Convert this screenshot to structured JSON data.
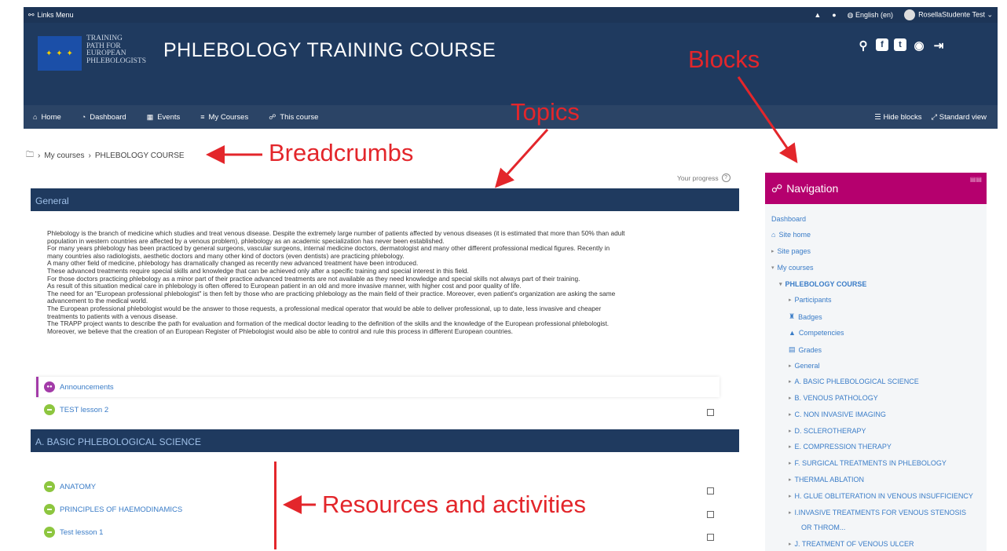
{
  "topbar": {
    "links_menu": "Links Menu",
    "language": "English (en)",
    "user": "RosellaStudente Test"
  },
  "header": {
    "logo_text_lines": [
      "TRAINING",
      "PATH FOR",
      "EUROPEAN",
      "PHLEBOLOGISTS"
    ],
    "title": "PHLEBOLOGY TRAINING COURSE",
    "icons": [
      "search-icon",
      "facebook-icon",
      "twitter-icon",
      "globe-icon",
      "logout-icon"
    ]
  },
  "navbar": {
    "items": [
      {
        "label": "Home",
        "icon": "home-icon"
      },
      {
        "label": "Dashboard",
        "icon": "dashboard-icon"
      },
      {
        "label": "Events",
        "icon": "calendar-icon"
      },
      {
        "label": "My Courses",
        "icon": "courses-icon"
      },
      {
        "label": "This course",
        "icon": "sitemap-icon"
      }
    ],
    "hide_blocks": "Hide blocks",
    "standard_view": "Standard view"
  },
  "breadcrumb": {
    "items": [
      "My courses",
      "PHLEBOLOGY COURSE"
    ],
    "sep": "›"
  },
  "annotations": {
    "blocks": "Blocks",
    "topics": "Topics",
    "breadcrumbs": "Breadcrumbs",
    "resources": "Resources and activities"
  },
  "progress_label": "Your progress",
  "sections": {
    "general": "General",
    "a": "A. BASIC PHLEBOLOGICAL SCIENCE"
  },
  "summary_lines": [
    "Phlebology is the branch of medicine which studies and treat venous disease. Despite the extremely large number of patients affected by venous diseases (it is estimated that more than 50% than adult",
    "population in western countries are affected by a venous problem), phlebology as an academic specialization has never been established.",
    "For many years phlebology has been practiced by general surgeons, vascular surgeons, internal medicine doctors, dermatologist and many other different professional medical figures. Recently in",
    "many countries also radiologists, aesthetic doctors and many other kind of doctors (even dentists) are practicing phlebology.",
    "A many other field of medicine, phlebology has dramatically changed as recently new advanced treatment have been introduced.",
    "These advanced treatments require special skills and knowledge that can be achieved only after a specific training and special interest in this field.",
    "For those doctors practicing phlebology as a minor part of their practice advanced treatments are not available as they need knowledge and special skills not always part of their training.",
    "As result of this situation medical care in phlebology is often offered to European patient in an old and more invasive manner, with higher cost and poor quality of life.",
    "The need for an \"European professional phlebologist\" is then felt by those who are practicing phlebology as the main field of their practice. Moreover, even patient's organization are asking the same",
    "advancement to the medical world.",
    "The European professional phlebologist would be the answer to those requests, a professional medical operator that would be able to deliver professional, up to date, less invasive and cheaper",
    "treatments to patients with a venous disease.",
    "The TRAPP project wants to describe the path for evaluation and formation of the medical doctor leading to the definition of the skills and the knowledge of the European professional phlebologist.",
    "Moreover, we believe that the creation of an European Register of Phlebologist would also be able to control and rule this process in different European countries."
  ],
  "activities": {
    "announcements": "Announcements",
    "test_lesson_2": "TEST lesson 2",
    "anatomy": "ANATOMY",
    "haemodinamics": "PRINCIPLES OF HAEMODINAMICS",
    "test_lesson_1": "Test lesson 1"
  },
  "navblock": {
    "title": "Navigation",
    "items": [
      "Dashboard",
      "Site home",
      "Site pages",
      "My courses",
      "PHLEBOLOGY COURSE",
      "Participants",
      "Badges",
      "Competencies",
      "Grades",
      "General",
      "A. BASIC PHLEBOLOGICAL SCIENCE",
      "B. VENOUS PATHOLOGY",
      "C. NON INVASIVE IMAGING",
      "D. SCLEROTHERAPY",
      "E. COMPRESSION THERAPY",
      "F. SURGICAL TREATMENTS IN PHLEBOLOGY",
      "THERMAL ABLATION",
      "H. GLUE OBLITERATION IN VENOUS INSUFFICIENCY",
      "I.INVASIVE TREATMENTS FOR VENOUS STENOSIS",
      "OR THROM...",
      "J. TREATMENT OF VENOUS ULCER"
    ]
  },
  "colors": {
    "header": "#1f3a5f",
    "navblock": "#b5006e",
    "annotation": "#e3262b",
    "link": "#3a7cc7"
  }
}
